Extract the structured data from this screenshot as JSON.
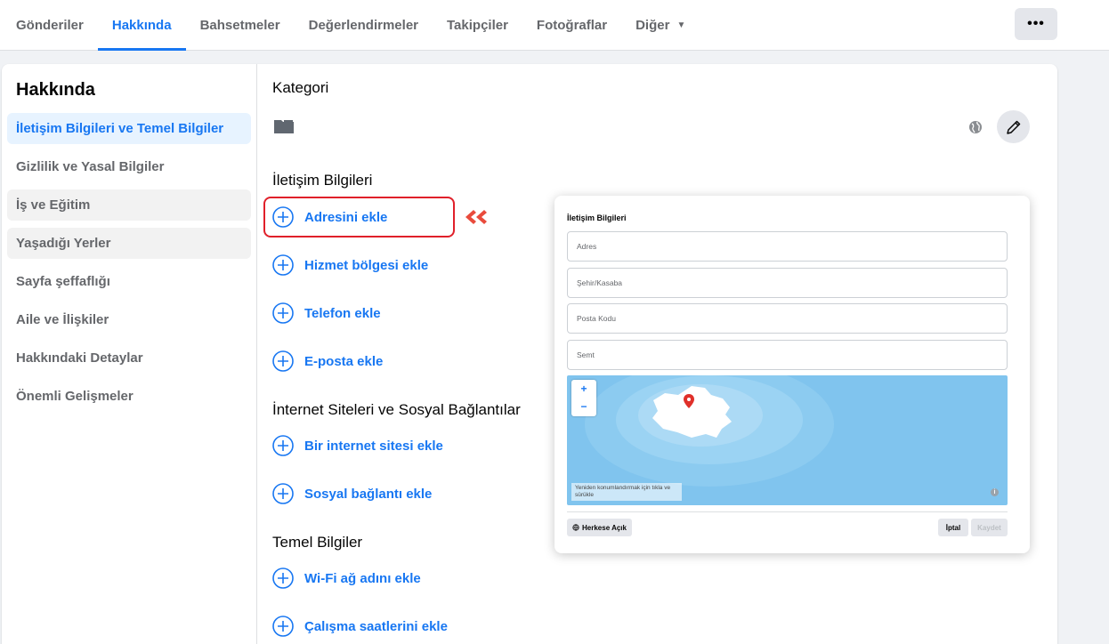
{
  "nav": {
    "tabs": [
      {
        "label": "Gönderiler"
      },
      {
        "label": "Hakkında"
      },
      {
        "label": "Bahsetmeler"
      },
      {
        "label": "Değerlendirmeler"
      },
      {
        "label": "Takipçiler"
      },
      {
        "label": "Fotoğraflar"
      },
      {
        "label": "Diğer"
      }
    ],
    "active_tab": "Hakkında",
    "more_label": "•••"
  },
  "sidebar": {
    "title": "Hakkında",
    "items": [
      {
        "label": "İletişim Bilgileri ve Temel Bilgiler"
      },
      {
        "label": "Gizlilik ve Yasal Bilgiler"
      },
      {
        "label": "İş ve Eğitim"
      },
      {
        "label": "Yaşadığı Yerler"
      },
      {
        "label": "Sayfa şeffaflığı"
      },
      {
        "label": "Aile ve İlişkiler"
      },
      {
        "label": "Hakkındaki Detaylar"
      },
      {
        "label": "Önemli Gelişmeler"
      }
    ],
    "active_item": "İletişim Bilgileri ve Temel Bilgiler"
  },
  "main": {
    "category_title": "Kategori",
    "contact": {
      "title": "İletişim Bilgileri",
      "items": [
        {
          "label": "Adresini ekle"
        },
        {
          "label": "Hizmet bölgesi ekle"
        },
        {
          "label": "Telefon ekle"
        },
        {
          "label": "E-posta ekle"
        }
      ]
    },
    "websites": {
      "title": "İnternet Siteleri ve Sosyal Bağlantılar",
      "items": [
        {
          "label": "Bir internet sitesi ekle"
        },
        {
          "label": "Sosyal bağlantı ekle"
        }
      ]
    },
    "basic": {
      "title": "Temel Bilgiler",
      "items": [
        {
          "label": "Wi-Fi ağ adını ekle"
        },
        {
          "label": "Çalışma saatlerini ekle"
        }
      ]
    }
  },
  "popup": {
    "title": "İletişim Bilgileri",
    "fields": [
      {
        "placeholder": "Adres"
      },
      {
        "placeholder": "Şehir/Kasaba"
      },
      {
        "placeholder": "Posta Kodu"
      },
      {
        "placeholder": "Semt"
      }
    ],
    "map": {
      "zoom_in": "+",
      "zoom_out": "−",
      "hint": "Yeniden konumlandırmak için tıkla ve sürükle",
      "info": "i"
    },
    "audience_label": "Herkese Açık",
    "cancel_label": "İptal",
    "save_label": "Kaydet"
  },
  "colors": {
    "accent": "#1877f2",
    "highlight": "#e0202a",
    "arrow": "#e94b3c",
    "map_water": "#80c4ee",
    "map_land": "#ffffff",
    "pin": "#e0302a"
  }
}
